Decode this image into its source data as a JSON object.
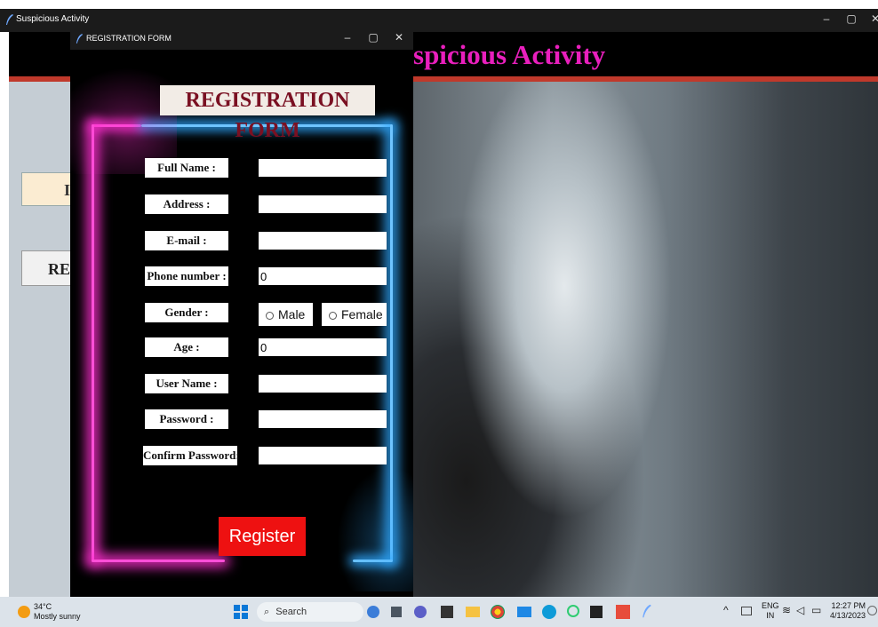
{
  "main_window": {
    "title": "Suspicious Activity",
    "header_title": "spicious Activity",
    "left_buttons": [
      "I",
      "RE"
    ]
  },
  "registration_window": {
    "title": "REGISTRATION FORM",
    "heading": "REGISTRATION FORM",
    "fields": [
      {
        "label": "Full Name :",
        "value": ""
      },
      {
        "label": "Address :",
        "value": ""
      },
      {
        "label": "E-mail :",
        "value": ""
      },
      {
        "label": "Phone number :",
        "value": "0"
      },
      {
        "label": "Gender :"
      },
      {
        "label": "Age :",
        "value": "0"
      },
      {
        "label": "User Name :",
        "value": ""
      },
      {
        "label": "Password :",
        "value": ""
      },
      {
        "label": "Confirm Password:",
        "value": ""
      }
    ],
    "gender_options": [
      "Male",
      "Female"
    ],
    "register_label": "Register"
  },
  "taskbar": {
    "weather_temp": "34°C",
    "weather_desc": "Mostly sunny",
    "search_label": "Search",
    "lang_top": "ENG",
    "lang_bottom": "IN",
    "time": "12:27 PM",
    "date": "4/13/2023"
  },
  "colors": {
    "header_title": "#e91fbd",
    "heading_text": "#7a1022",
    "register_bg": "#ee1111",
    "glow_pink": "#ff2fd0",
    "glow_blue": "#2fa8ff"
  }
}
